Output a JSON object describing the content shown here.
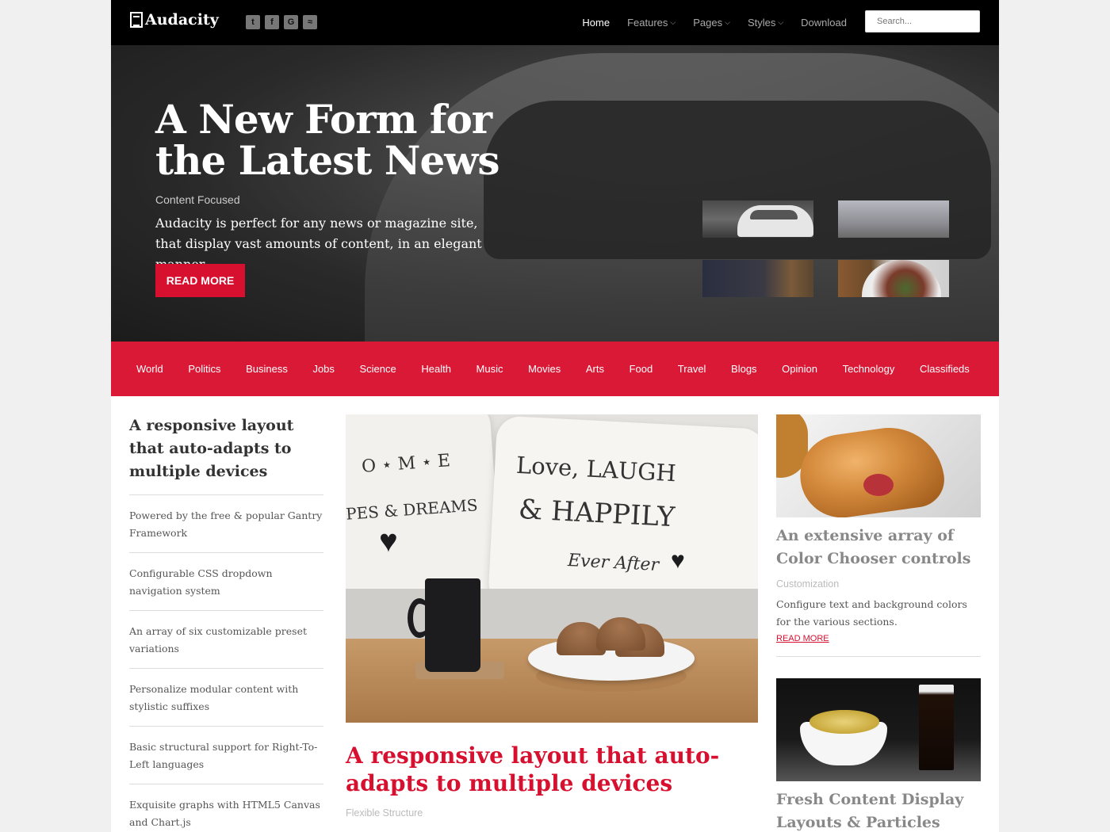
{
  "brand": {
    "name": "Audacity"
  },
  "socials": [
    {
      "glyph": "t",
      "icon": "twitter-icon"
    },
    {
      "glyph": "f",
      "icon": "facebook-icon"
    },
    {
      "glyph": "G",
      "icon": "google-icon"
    },
    {
      "glyph": "≈",
      "icon": "rss-icon"
    }
  ],
  "nav": {
    "items": [
      {
        "label": "Home",
        "active": true,
        "dropdown": false
      },
      {
        "label": "Features",
        "active": false,
        "dropdown": true
      },
      {
        "label": "Pages",
        "active": false,
        "dropdown": true
      },
      {
        "label": "Styles",
        "active": false,
        "dropdown": true
      },
      {
        "label": "Download",
        "active": false,
        "dropdown": false
      }
    ],
    "search_placeholder": "Search..."
  },
  "hero": {
    "title": "A New Form for the Latest News",
    "subtitle": "Content Focused",
    "text": "Audacity is perfect for any news or magazine site, that display vast amounts of content, in an elegant manner.",
    "button": "READ MORE"
  },
  "categories": [
    "World",
    "Politics",
    "Business",
    "Jobs",
    "Science",
    "Health",
    "Music",
    "Movies",
    "Arts",
    "Food",
    "Travel",
    "Blogs",
    "Opinion",
    "Technology",
    "Classifieds"
  ],
  "left": {
    "title": "A responsive layout that auto-adapts to multiple devices",
    "items": [
      "Powered by the free & popular Gantry Framework",
      "Configurable CSS dropdown navigation system",
      "An array of six customizable preset variations",
      "Personalize modular content with stylistic suffixes",
      "Basic structural support for Right-To-Left languages",
      "Exquisite graphs with HTML5 Canvas and Chart.js"
    ]
  },
  "center": {
    "image_text": {
      "line1": "Love, LAUGH",
      "line2": "& HAPPILY",
      "line3": "Ever After",
      "line4": "O ⋆ M ⋆ E",
      "line5": "PES & DREAMS"
    },
    "title": "A responsive layout that auto-adapts to multiple devices",
    "subtitle": "Flexible Structure"
  },
  "right": [
    {
      "title": "An extensive array of Color Chooser controls",
      "subtitle": "Customization",
      "text": "Configure text and background colors for the various sections.",
      "link": "READ MORE"
    },
    {
      "title": "Fresh Content Display Layouts & Particles"
    }
  ],
  "colors": {
    "accent": "#d8102f",
    "topbar": "#000000",
    "category_bar": "#da1937"
  }
}
